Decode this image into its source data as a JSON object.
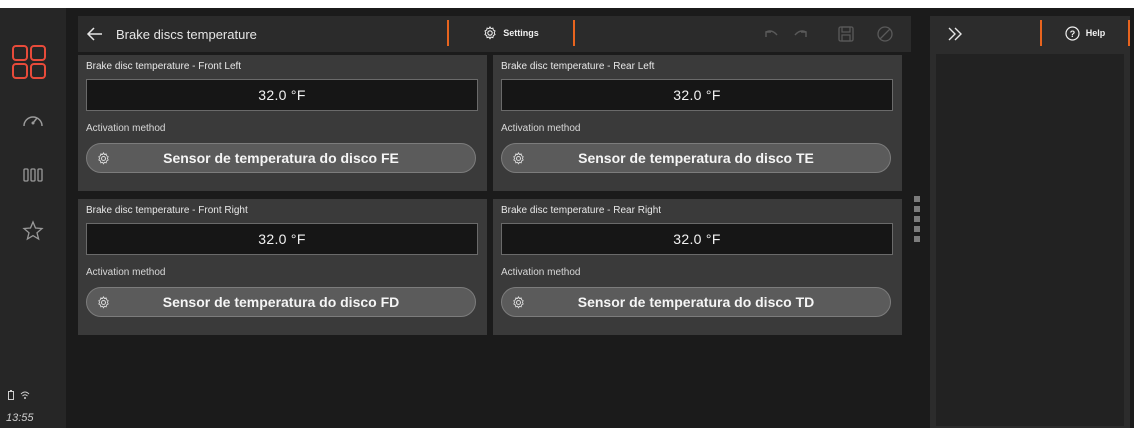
{
  "header": {
    "title": "Brake discs temperature",
    "settings_label": "Settings"
  },
  "help": {
    "label": "Help"
  },
  "status": {
    "time": "13:55"
  },
  "cards": [
    {
      "title": "Brake disc temperature - Front Left",
      "value": "32.0 °F",
      "activation_label": "Activation method",
      "button_label": "Sensor de temperatura do disco FE"
    },
    {
      "title": "Brake disc temperature - Rear Left",
      "value": "32.0 °F",
      "activation_label": "Activation method",
      "button_label": "Sensor de temperatura do disco TE"
    },
    {
      "title": "Brake disc temperature - Front Right",
      "value": "32.0 °F",
      "activation_label": "Activation method",
      "button_label": "Sensor de temperatura do disco FD"
    },
    {
      "title": "Brake disc temperature - Rear Right",
      "value": "32.0 °F",
      "activation_label": "Activation method",
      "button_label": "Sensor de temperatura do disco TD"
    }
  ],
  "colors": {
    "accent": "#e8641e",
    "logo": "#e84b3a"
  }
}
